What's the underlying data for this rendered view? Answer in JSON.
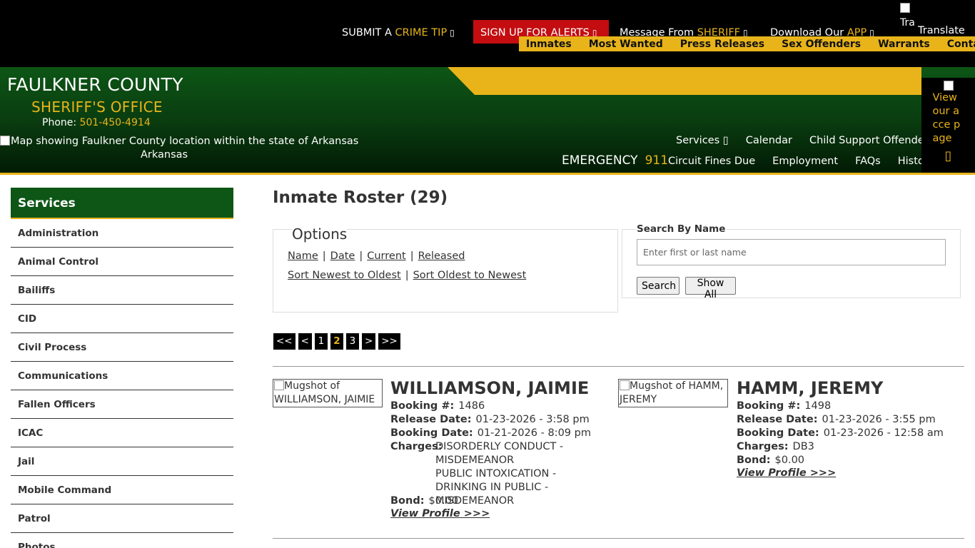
{
  "topbar": {
    "crime_tip_prefix": "SUBMIT A",
    "crime_tip_gold": "CRIME TIP",
    "alerts_label": "SIGN UP FOR ALERTS",
    "message_prefix": "Message From",
    "message_gold": "SHERIFF",
    "download_prefix": "Download Our",
    "download_gold": "APP",
    "translate_img_alt": "Tra",
    "translate_label": "Translate",
    "icon_name": "external-link-icon"
  },
  "gold_nav": [
    "Inmates",
    "Most Wanted",
    "Press Releases",
    "Sex Offenders",
    "Warrants",
    "Contact"
  ],
  "header": {
    "county": "FAULKNER COUNTY",
    "office": "SHERIFF'S OFFICE",
    "phone_label": "Phone:",
    "phone_number": "501-450-4914",
    "map_alt": "Map showing Faulkner County location within the state of Arkansas",
    "map_sub": "Arkansas",
    "emergency_label": "EMERGENCY",
    "emergency_number": "911",
    "nav_row1": [
      "Services",
      "Calendar",
      "Child Support Offenders"
    ],
    "nav_row2": [
      "Circuit Fines Due",
      "Employment",
      "FAQs",
      "History"
    ],
    "access_text": "View our acce page"
  },
  "sidebar": {
    "title": "Services",
    "items": [
      "Administration",
      "Animal Control",
      "Bailiffs",
      "CID",
      "Civil Process",
      "Communications",
      "Fallen Officers",
      "ICAC",
      "Jail",
      "Mobile Command",
      "Patrol",
      "Photos"
    ]
  },
  "main": {
    "title": "Inmate Roster (29)",
    "options": {
      "title": "Options",
      "sort_fields": [
        "Name",
        "Date",
        "Current",
        "Released"
      ],
      "sort_orders": [
        "Sort Newest to Oldest",
        "Sort Oldest to Newest"
      ]
    },
    "search": {
      "legend": "Search By Name",
      "placeholder": "Enter first or last name",
      "search_button": "Search",
      "show_all_button": "Show All"
    },
    "pager": [
      "<<",
      "<",
      "1",
      "2",
      "3",
      ">",
      ">>"
    ],
    "pager_active": "2",
    "inmates": [
      {
        "mug_alt": "Mugshot of WILLIAMSON, JAIMIE",
        "name": "WILLIAMSON, JAIMIE",
        "booking_label": "Booking #:",
        "booking": "1486",
        "release_label": "Release Date:",
        "release": "01-23-2026 - 3:58 pm",
        "booking_date_label": "Booking Date:",
        "booking_date": "01-21-2026 - 8:09 pm",
        "charges_label": "Charges:",
        "charges": [
          "DISORDERLY CONDUCT - MISDEMEANOR",
          "PUBLIC INTOXICATION - DRINKING IN PUBLIC - MISDEMEANOR"
        ],
        "bond_label": "Bond:",
        "bond": "$0.00",
        "view_link": "View Profile >>>"
      },
      {
        "mug_alt": "Mugshot of HAMM, JEREMY",
        "name": "HAMM, JEREMY",
        "booking_label": "Booking #:",
        "booking": "1498",
        "release_label": "Release Date:",
        "release": "01-23-2026 - 3:55 pm",
        "booking_date_label": "Booking Date:",
        "booking_date": "01-23-2026 - 12:58 am",
        "charges_label": "Charges:",
        "charges": [
          "DB3"
        ],
        "bond_label": "Bond:",
        "bond": "$0.00",
        "view_link": "View Profile >>>"
      }
    ]
  },
  "colors": {
    "gold": "#e8b41a",
    "green": "#0d5616",
    "alert_red": "#c30d10",
    "black": "#000000"
  }
}
